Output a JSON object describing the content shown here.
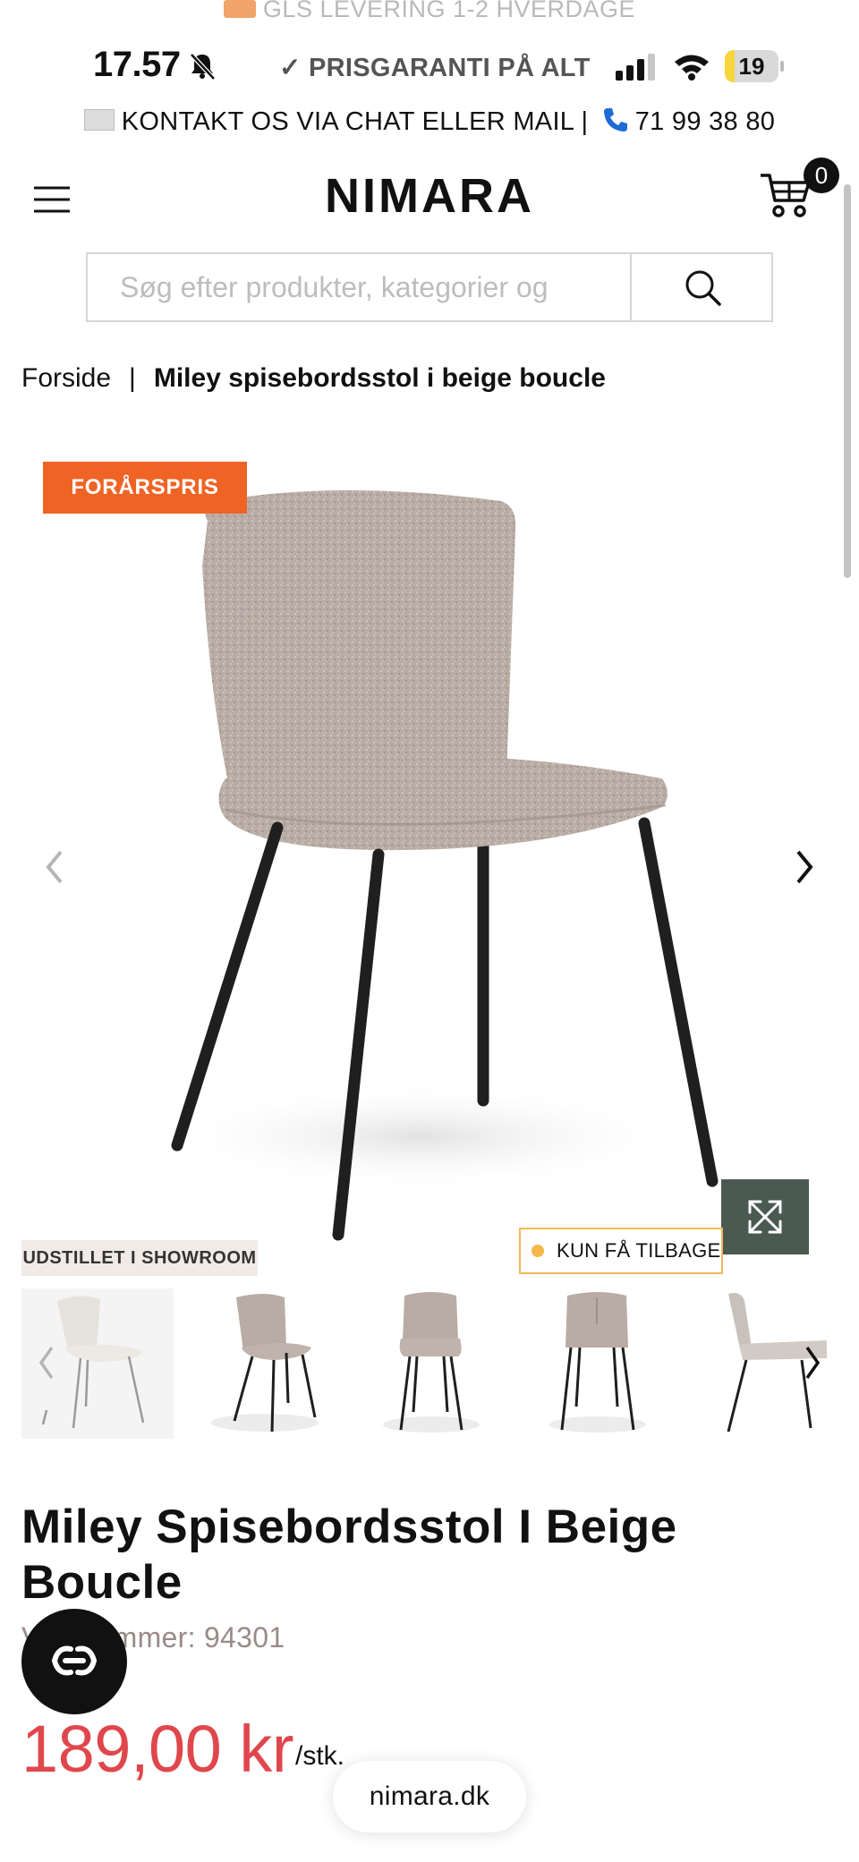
{
  "top_banner": {
    "text": "GLS LEVERING 1-2 HVERDAGE"
  },
  "status_bar": {
    "time": "17.57",
    "promo": "✓ PRISGARANTI PÅ ALT",
    "battery_level": "19",
    "battery_fraction": 0.19
  },
  "contact_bar": {
    "text": "KONTAKT OS VIA CHAT ELLER MAIL |",
    "phone": "71 99 38 80"
  },
  "header": {
    "logo": "NIMARA",
    "cart_count": "0"
  },
  "search": {
    "placeholder": "Søg efter produkter, kategorier og"
  },
  "breadcrumb": {
    "home": "Forside",
    "separator": "|",
    "current": "Miley spisebordsstol i beige boucle"
  },
  "gallery": {
    "sale_badge": "FORÅRSPRIS",
    "showroom_badge": "UDSTILLET I SHOWROOM",
    "stock_badge": "KUN FÅ TILBAGE"
  },
  "product": {
    "title": "Miley Spisebordsstol I Beige Boucle",
    "sku": "Varenummer: 94301",
    "price": "189,00 kr",
    "price_unit": "/stk."
  },
  "browser": {
    "url": "nimara.dk"
  },
  "colors": {
    "sale": "#ef6425",
    "price": "#e0474c",
    "expand": "#4a5a52",
    "stock_border": "#f3b85b"
  }
}
